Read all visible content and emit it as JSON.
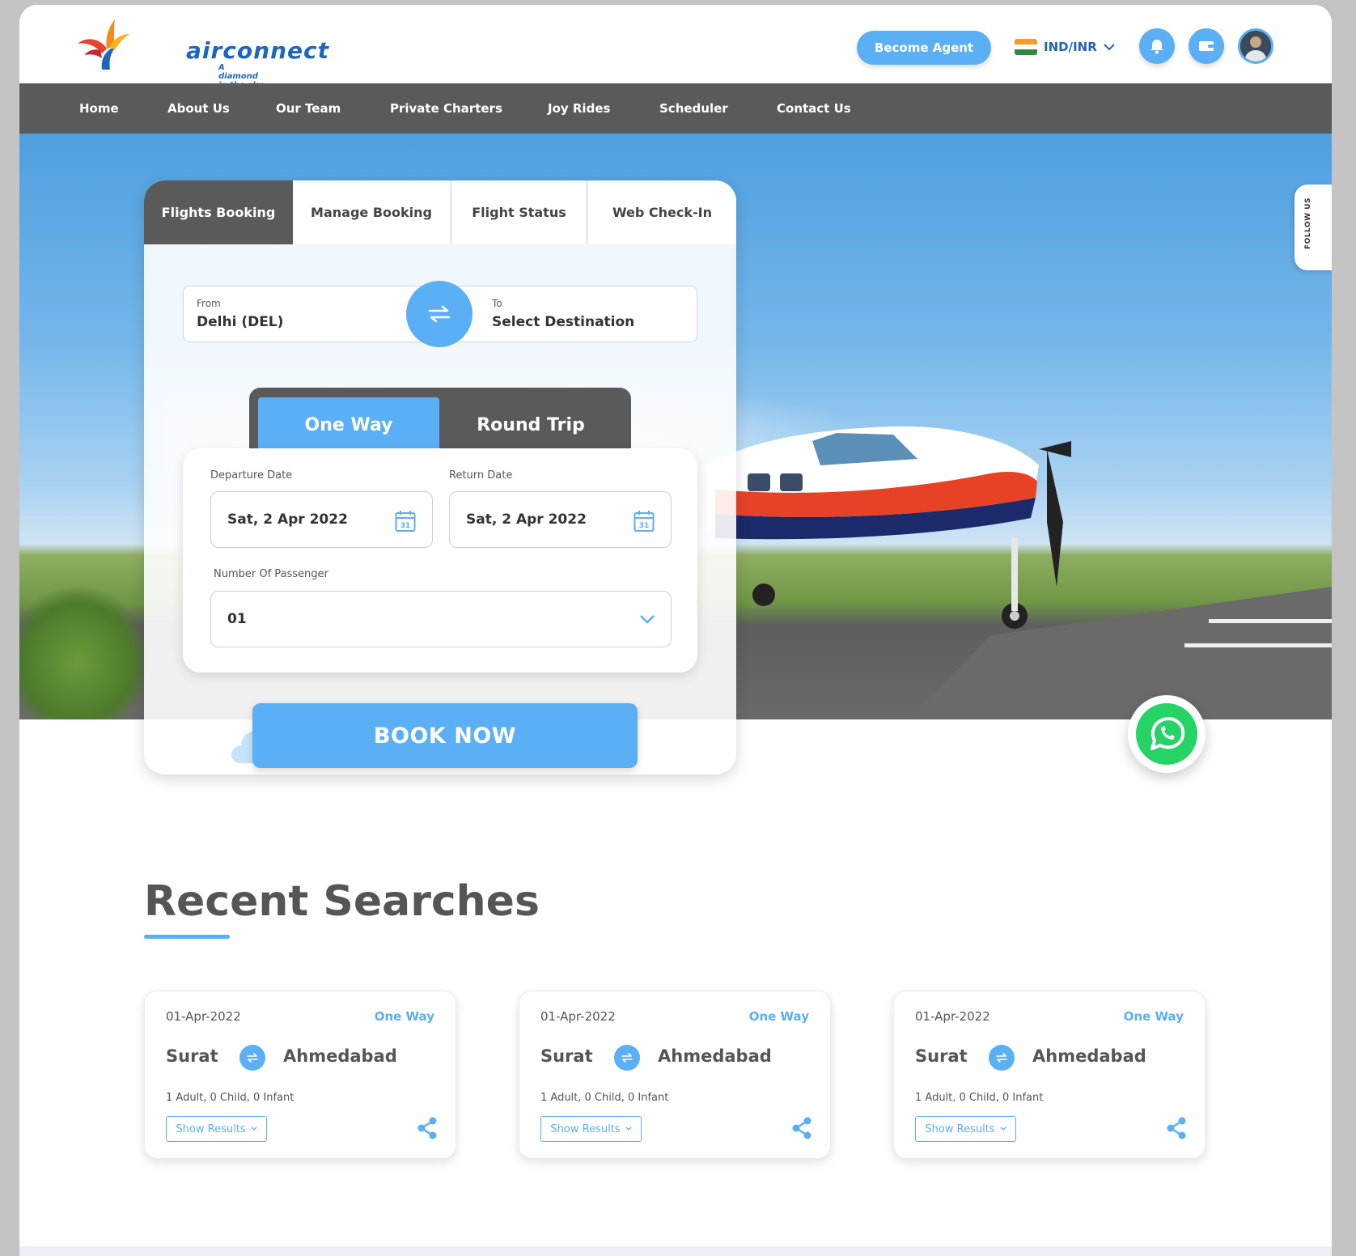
{
  "header": {
    "logo_text": "airconnect",
    "logo_tagline": "A diamond in the sky",
    "become_agent_label": "Become Agent",
    "currency_label": "IND/INR",
    "bell_icon": "bell-icon",
    "wallet_icon": "wallet-icon"
  },
  "nav": {
    "items": [
      "Home",
      "About Us",
      "Our Team",
      "Private Charters",
      "Joy Rides",
      "Scheduler",
      "Contact Us"
    ]
  },
  "follow_label": "FOLLOW US",
  "booking": {
    "tabs": [
      "Flights Booking",
      "Manage Booking",
      "Flight Status",
      "Web Check-In"
    ],
    "active_tab": "Flights Booking",
    "from_label": "From",
    "from_value": "Delhi (DEL)",
    "to_label": "To",
    "to_value": "Select Destination",
    "trip_types": [
      "One Way",
      "Round Trip"
    ],
    "active_trip": "One Way",
    "departure_label": "Departure Date",
    "departure_value": "Sat, 2 Apr 2022",
    "return_label": "Return Date",
    "return_value": "Sat, 2 Apr 2022",
    "calendar_day": "31",
    "passenger_label": "Number Of Passenger",
    "passenger_value": "01",
    "book_label": "BOOK NOW"
  },
  "recent": {
    "title": "Recent Searches",
    "cards": [
      {
        "date": "01-Apr-2022",
        "type": "One Way",
        "from": "Surat",
        "to": "Ahmedabad",
        "pax": "1 Adult, 0 Child, 0 Infant",
        "action": "Show Results"
      },
      {
        "date": "01-Apr-2022",
        "type": "One Way",
        "from": "Surat",
        "to": "Ahmedabad",
        "pax": "1 Adult, 0 Child, 0 Infant",
        "action": "Show Results"
      },
      {
        "date": "01-Apr-2022",
        "type": "One Way",
        "from": "Surat",
        "to": "Ahmedabad",
        "pax": "1 Adult, 0 Child, 0 Infant",
        "action": "Show Results"
      }
    ]
  },
  "colors": {
    "accent": "#5aaff5",
    "brand": "#1f66b8",
    "nav_bg": "#5a5a5a",
    "whatsapp": "#25d366"
  }
}
